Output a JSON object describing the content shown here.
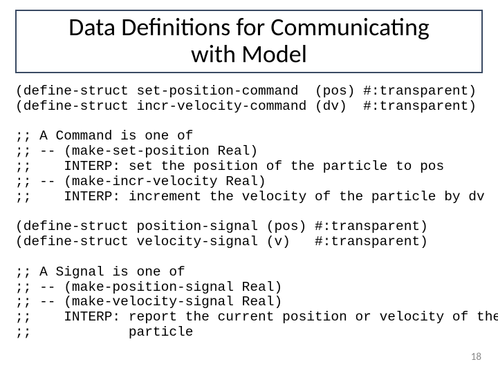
{
  "title_line1": "Data Definitions for Communicating",
  "title_line2": "with Model",
  "code": "(define-struct set-position-command  (pos) #:transparent)\n(define-struct incr-velocity-command (dv)  #:transparent)\n\n;; A Command is one of\n;; -- (make-set-position Real)\n;;    INTERP: set the position of the particle to pos\n;; -- (make-incr-velocity Real)\n;;    INTERP: increment the velocity of the particle by dv\n\n(define-struct position-signal (pos) #:transparent)\n(define-struct velocity-signal (v)   #:transparent)\n\n;; A Signal is one of\n;; -- (make-position-signal Real)\n;; -- (make-velocity-signal Real)\n;;    INTERP: report the current position or velocity of the\n;;            particle",
  "page_number": "18"
}
